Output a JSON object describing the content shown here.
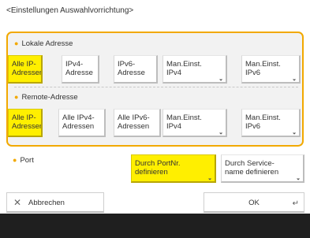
{
  "title": "<Einstellungen Auswahlvorrichtung>",
  "local": {
    "label": "Lokale Adresse",
    "buttons": [
      {
        "label": "Alle IP-\nAdressen",
        "selected": true
      },
      {
        "label": "IPv4-\nAdresse",
        "selected": false
      },
      {
        "label": "IPv6-\nAdresse",
        "selected": false
      },
      {
        "label": "Man.Einst.\nIPv4",
        "selected": false,
        "arrow": true
      },
      {
        "label": "Man.Einst.\nIPv6",
        "selected": false,
        "arrow": true
      }
    ]
  },
  "remote": {
    "label": "Remote-Adresse",
    "buttons": [
      {
        "label": "Alle IP-\nAdressen",
        "selected": true
      },
      {
        "label": "Alle IPv4-\nAdressen",
        "selected": false
      },
      {
        "label": "Alle IPv6-\nAdressen",
        "selected": false
      },
      {
        "label": "Man.Einst.\nIPv4",
        "selected": false,
        "arrow": true
      },
      {
        "label": "Man.Einst.\nIPv6",
        "selected": false,
        "arrow": true
      }
    ]
  },
  "port": {
    "label": "Port",
    "buttons": [
      {
        "label": "Durch PortNr.\ndefinieren",
        "selected": true,
        "arrow": true
      },
      {
        "label": "Durch Service-\nname definieren",
        "selected": false,
        "arrow": true
      }
    ]
  },
  "footer": {
    "cancel_label": "Abbrechen",
    "ok_label": "OK"
  },
  "colors": {
    "accent": "#f2a900",
    "selected": "#ffef00",
    "bottom_bar": "#1f1f1f"
  }
}
